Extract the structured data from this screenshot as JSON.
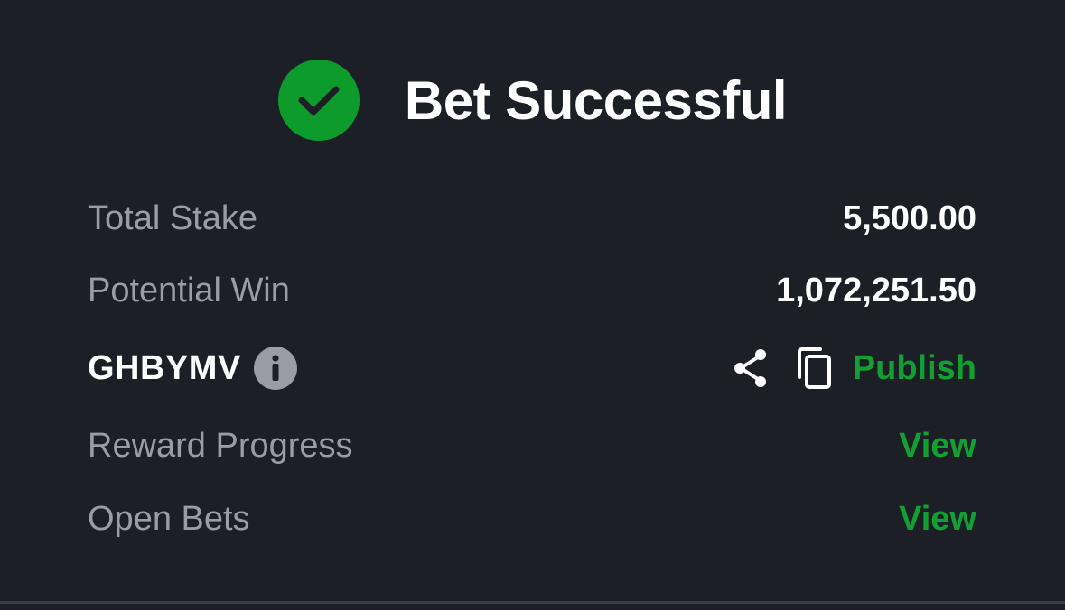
{
  "header": {
    "title": "Bet Successful",
    "status_icon": "check-circle-icon",
    "accent_color": "#0d9b2c"
  },
  "summary": {
    "total_stake_label": "Total Stake",
    "total_stake_value": "5,500.00",
    "potential_win_label": "Potential Win",
    "potential_win_value": "1,072,251.50"
  },
  "booking": {
    "code": "GHBYMV",
    "info_icon": "info-icon",
    "share_icon": "share-icon",
    "copy_icon": "copy-icon",
    "publish_label": "Publish"
  },
  "links": {
    "reward_progress_label": "Reward Progress",
    "reward_progress_action": "View",
    "open_bets_label": "Open Bets",
    "open_bets_action": "View",
    "link_color": "#12a032"
  }
}
